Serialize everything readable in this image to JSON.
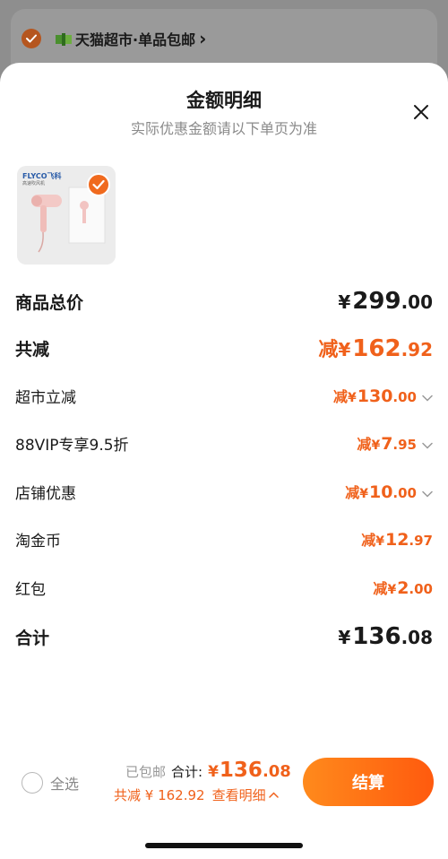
{
  "background": {
    "store_name": "天猫超市·单品包邮",
    "chevron": "›"
  },
  "sheet": {
    "title": "金额明细",
    "subtitle": "实际优惠金额请以下单页为准",
    "close_icon": "close-icon"
  },
  "product": {
    "brand": "FLYCO飞科",
    "brand_sub": "高速吹风机",
    "selected": true
  },
  "rows": {
    "goods_total": {
      "label": "商品总价",
      "prefix": "",
      "yen": "¥",
      "int": "299",
      "dec": ".00"
    },
    "total_reduction": {
      "label": "共减",
      "prefix": "减",
      "yen": "¥",
      "int": "162",
      "dec": ".92"
    },
    "supermarket": {
      "label": "超市立减",
      "prefix": "减",
      "yen": "¥",
      "int": "130",
      "dec": ".00"
    },
    "vip": {
      "label": "88VIP专享9.5折",
      "prefix": "减",
      "yen": "¥",
      "int": "7",
      "dec": ".95"
    },
    "store": {
      "label": "店铺优惠",
      "prefix": "减",
      "yen": "¥",
      "int": "10",
      "dec": ".00"
    },
    "taojinbi": {
      "label": "淘金币",
      "prefix": "减",
      "yen": "¥",
      "int": "12",
      "dec": ".97"
    },
    "hongbao": {
      "label": "红包",
      "prefix": "减",
      "yen": "¥",
      "int": "2",
      "dec": ".00"
    },
    "sum": {
      "label": "合计",
      "prefix": "",
      "yen": "¥",
      "int": "136",
      "dec": ".08"
    }
  },
  "bottom_bar": {
    "select_all": "全选",
    "shipped": "已包邮",
    "total_label": "合计:",
    "total_yen": "¥",
    "total_int": "136",
    "total_dec": ".08",
    "saving": "共减 ¥ 162.92",
    "view_detail": "查看明细",
    "checkout": "结算"
  },
  "colors": {
    "accent": "#f0611b",
    "checkout_gradient_start": "#ff8a1c",
    "checkout_gradient_end": "#ff5a0e"
  }
}
